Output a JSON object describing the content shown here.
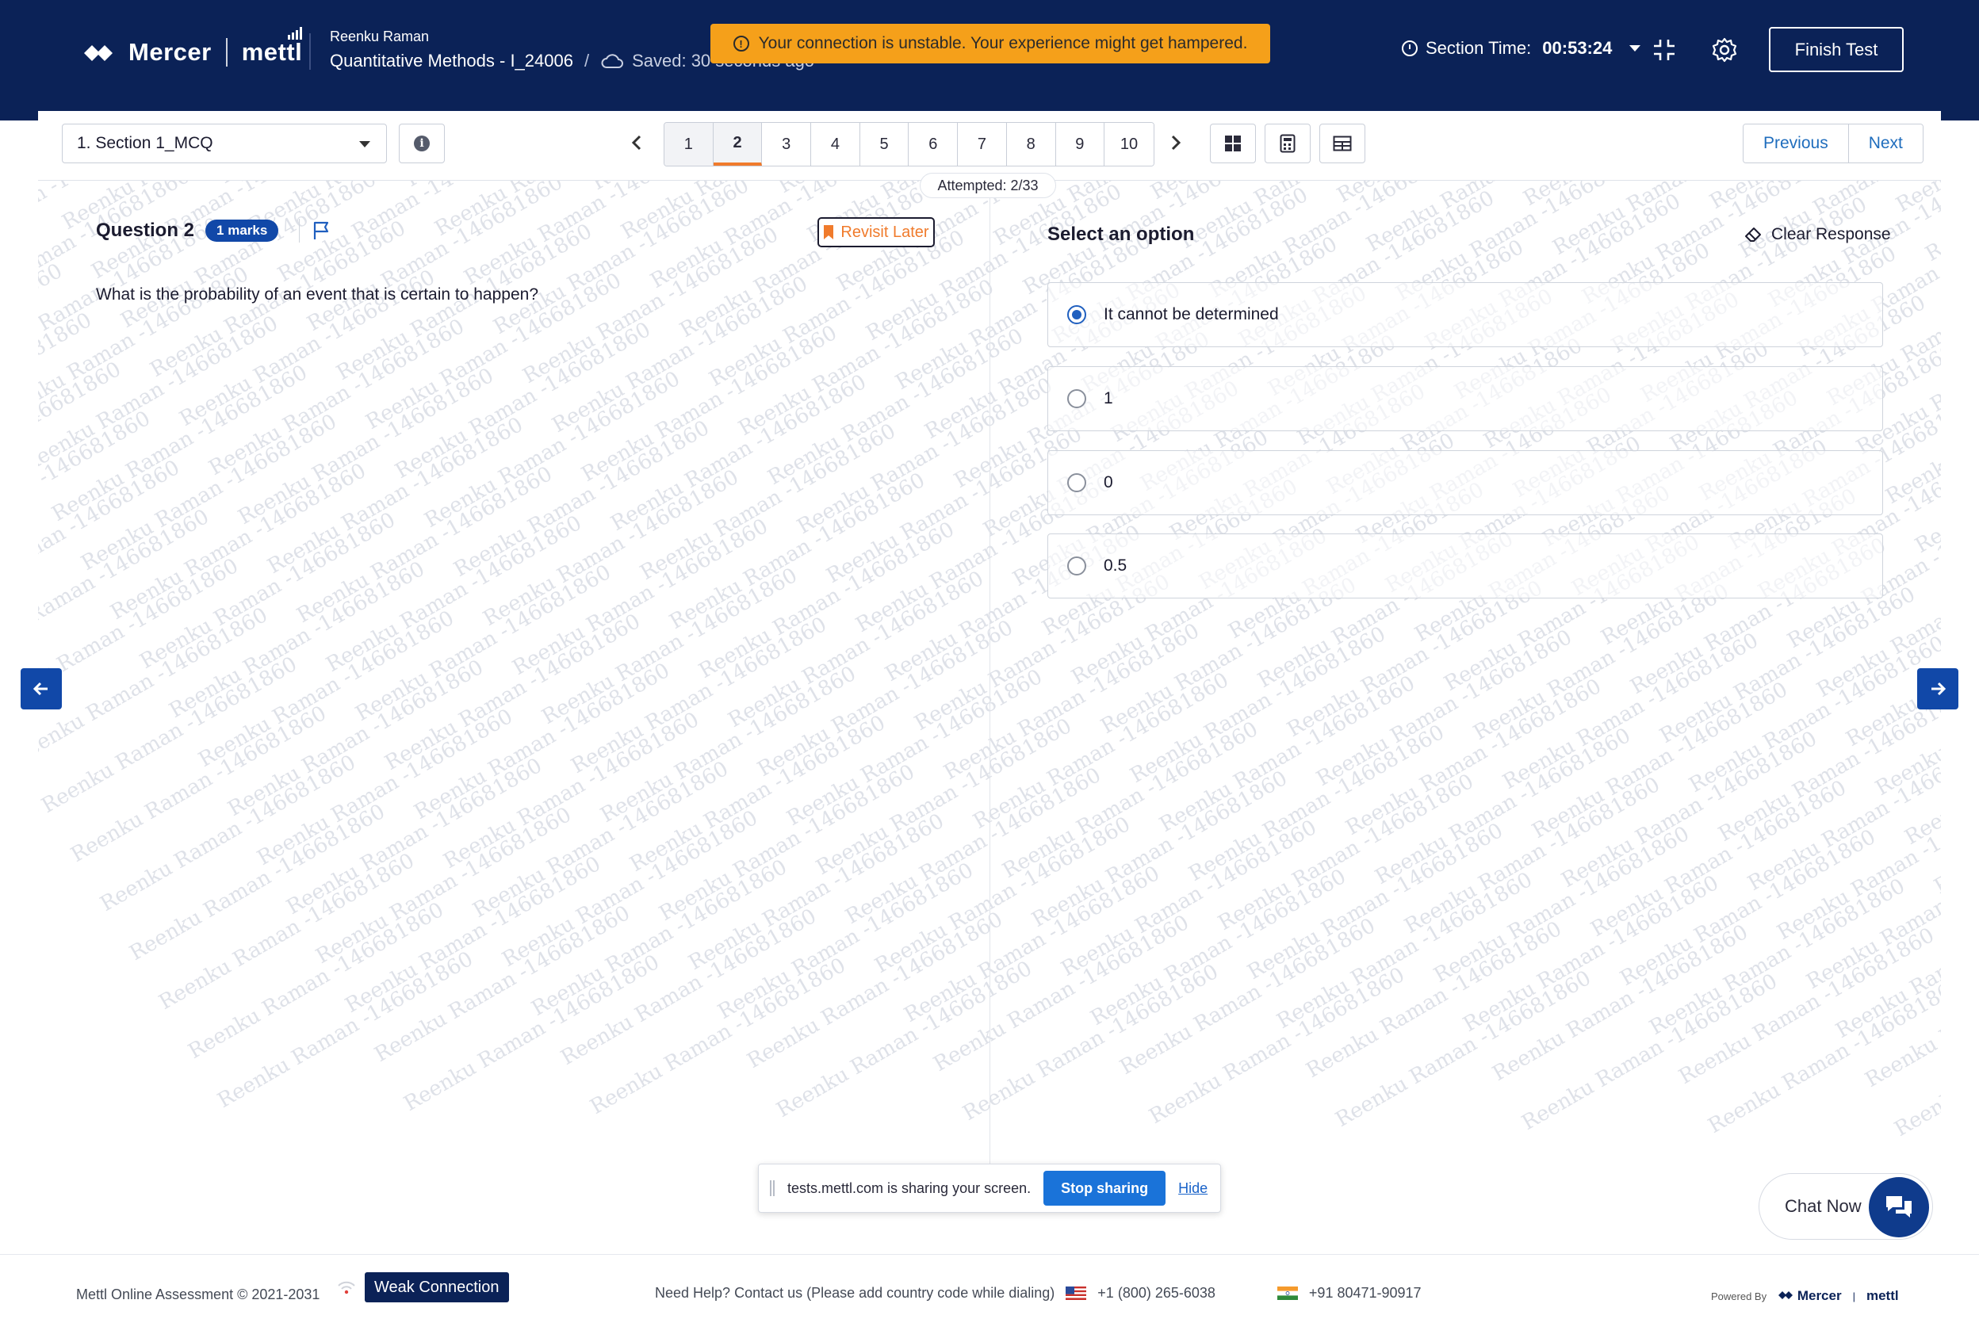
{
  "header": {
    "brand": "Mercer",
    "brand2": "mettl",
    "candidate": "Reenku Raman",
    "test_title": "Quantitative Methods - I_24006",
    "saved": "Saved: 30 seconds ago",
    "warning": "Your connection is unstable. Your experience might get hampered.",
    "section_time_label": "Section Time:",
    "section_time_value": "00:53:24",
    "finish_label": "Finish Test"
  },
  "toolbar": {
    "section": "1. Section 1_MCQ",
    "pages": [
      "1",
      "2",
      "3",
      "4",
      "5",
      "6",
      "7",
      "8",
      "9",
      "10"
    ],
    "current_page": "2",
    "attempted": "Attempted: 2/33",
    "previous_label": "Previous",
    "next_label": "Next"
  },
  "question": {
    "title": "Question 2",
    "marks": "1 marks",
    "revisit": "Revisit Later",
    "text": "What is the probability of an event that is certain to happen?"
  },
  "answer": {
    "heading": "Select an option",
    "clear": "Clear Response",
    "options": [
      {
        "label": "It cannot be determined",
        "selected": true
      },
      {
        "label": "1",
        "selected": false
      },
      {
        "label": "0",
        "selected": false
      },
      {
        "label": "0.5",
        "selected": false
      }
    ]
  },
  "watermark": "Reenku Raman -146681860",
  "share": {
    "message": "tests.mettl.com is sharing your screen.",
    "stop": "Stop sharing",
    "hide": "Hide"
  },
  "chat": {
    "label": "Chat Now"
  },
  "footer": {
    "copyright": "Mettl Online Assessment © 2021-2031",
    "weak": "Weak Connection",
    "help": "Need Help? Contact us (Please add country code while dialing)",
    "phone_us": "+1 (800) 265-6038",
    "phone_in": "+91 80471-90917",
    "powered_by": "Powered By",
    "powered_brand": "Mercer",
    "powered_brand2": "mettl"
  },
  "colors": {
    "header_bg": "#0b2257",
    "warning_bg": "#f5a01a",
    "accent_blue": "#1148a8",
    "current_page_underline": "#f07b2c",
    "revisit_orange": "#f07b2c"
  }
}
